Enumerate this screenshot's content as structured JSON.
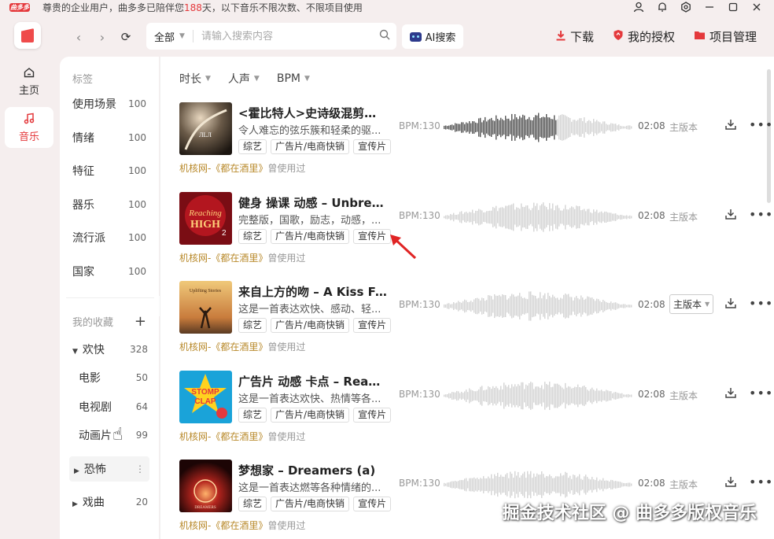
{
  "titlebar": {
    "logo": "曲多多",
    "notice_prefix": "尊贵的企业用户，曲多多已陪伴您",
    "notice_days": "188",
    "notice_suffix": "天，以下音乐不限次数、不限项目使用",
    "icons": [
      "user-icon",
      "bell-icon",
      "settings-icon",
      "minimize-icon",
      "maximize-icon",
      "close-icon"
    ]
  },
  "rail": {
    "items": [
      {
        "label": "主页",
        "icon": "home-icon"
      },
      {
        "label": "音乐",
        "icon": "music-note-icon",
        "active": true
      }
    ]
  },
  "search": {
    "scope": "全部",
    "placeholder": "请输入搜索内容",
    "ai_label": "AI搜索"
  },
  "top_actions": [
    {
      "label": "下载",
      "icon": "download-icon"
    },
    {
      "label": "我的授权",
      "icon": "shield-icon"
    },
    {
      "label": "项目管理",
      "icon": "folder-icon"
    }
  ],
  "tags": {
    "header": "标签",
    "items": [
      {
        "label": "使用场景",
        "count": "100"
      },
      {
        "label": "情绪",
        "count": "100"
      },
      {
        "label": "特征",
        "count": "100"
      },
      {
        "label": "器乐",
        "count": "100"
      },
      {
        "label": "流行派",
        "count": "100"
      },
      {
        "label": "国家",
        "count": "100"
      }
    ]
  },
  "favorites": {
    "header": "我的收藏",
    "items": [
      {
        "label": "欢快",
        "count": "328",
        "expanded": true,
        "level": 0
      },
      {
        "label": "电影",
        "count": "50",
        "level": 1
      },
      {
        "label": "电视剧",
        "count": "64",
        "level": 1
      },
      {
        "label": "动画片",
        "count": "99",
        "level": 1
      },
      {
        "label": "恐怖",
        "count": "",
        "expanded": false,
        "level": 0,
        "hover": true
      },
      {
        "label": "戏曲",
        "count": "20",
        "expanded": false,
        "level": 0
      }
    ]
  },
  "filters": [
    "时长",
    "人声",
    "BPM"
  ],
  "tracks": [
    {
      "title": "<霍比特人>史诗级混剪燃...",
      "desc": "令人难忘的弦乐簇和轻柔的驱...",
      "tags": [
        "综艺",
        "广告片/电商快销",
        "宣传片"
      ],
      "bpm": "BPM:130",
      "duration": "02:08",
      "version": "主版本",
      "used_prefix": "机核网-《都在酒里》",
      "used_suffix": "曾使用过",
      "played": 0.6
    },
    {
      "title": "健身 操课 动感 – Unbrea...",
      "desc": "完整版，国歌，励志，动感，...",
      "tags": [
        "综艺",
        "广告片/电商快销",
        "宣传片"
      ],
      "bpm": "BPM:130",
      "duration": "02:08",
      "version": "主版本",
      "used_prefix": "机核网-《都在酒里》",
      "used_suffix": "曾使用过",
      "played": 0
    },
    {
      "title": "来自上方的吻 – A Kiss Fr...",
      "desc": "这是一首表达欢快、感动、轻...",
      "tags": [
        "综艺",
        "广告片/电商快销",
        "宣传片"
      ],
      "bpm": "BPM:130",
      "duration": "02:08",
      "version": "主版本",
      "version_dropdown": true,
      "used_prefix": "机核网-《都在酒里》",
      "used_suffix": "曾使用过",
      "played": 0
    },
    {
      "title": "广告片 动感 卡点 – Read...",
      "desc": "这是一首表达欢快、热情等各...",
      "tags": [
        "综艺",
        "广告片/电商快销",
        "宣传片"
      ],
      "bpm": "BPM:130",
      "duration": "02:08",
      "version": "主版本",
      "used_prefix": "机核网-《都在酒里》",
      "used_suffix": "曾使用过",
      "played": 0
    },
    {
      "title": "梦想家 – Dreamers (a)",
      "desc": "这是一首表达燃等各种情绪的...",
      "tags": [
        "综艺",
        "广告片/电商快销",
        "宣传片"
      ],
      "bpm": "BPM:130",
      "duration": "02:08",
      "version": "主版本",
      "used_prefix": "机核网-《都在酒里》",
      "used_suffix": "曾使用过",
      "played": 0
    }
  ],
  "watermark": "掘金技术社区 @ 曲多多版权音乐",
  "colors": {
    "accent": "#e4393c",
    "org_link": "#b8892a",
    "wave_played": "#555555",
    "wave_idle": "#d4d4d4"
  }
}
